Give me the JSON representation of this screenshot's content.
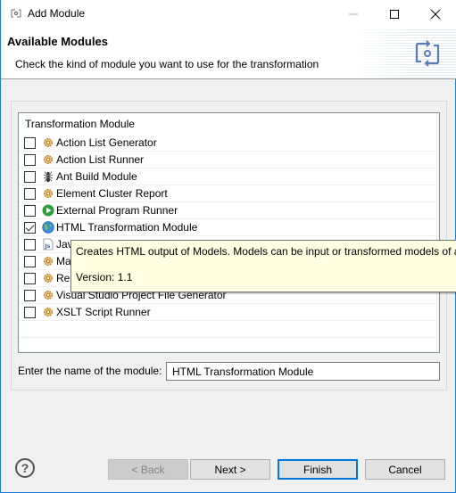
{
  "window": {
    "title": "Add Module",
    "icon": "module-transform-icon",
    "controls": {
      "minimize": "—",
      "maximize": "☐",
      "close": "✕"
    }
  },
  "header": {
    "title": "Available Modules",
    "description": "Check the kind of module you want to use for the transformation",
    "icon": "module-transform-icon"
  },
  "table": {
    "column_header": "Transformation Module",
    "rows": [
      {
        "label": "Action List Generator",
        "icon": "gear-icon",
        "checked": false
      },
      {
        "label": "Action List Runner",
        "icon": "gear-icon",
        "checked": false
      },
      {
        "label": "Ant Build Module",
        "icon": "ant-icon",
        "checked": false
      },
      {
        "label": "Element Cluster Report",
        "icon": "gear-icon",
        "checked": false
      },
      {
        "label": "External Program Runner",
        "icon": "play-icon",
        "checked": false
      },
      {
        "label": "HTML Transformation Module",
        "icon": "globe-icon",
        "checked": true
      },
      {
        "label": "Java",
        "icon": "javascript-file-icon",
        "checked": false
      },
      {
        "label": "Ma",
        "icon": "gear-icon",
        "checked": false
      },
      {
        "label": "Reu",
        "icon": "gear-icon",
        "checked": false
      },
      {
        "label": "Visual Studio Project File Generator",
        "icon": "gear-icon",
        "checked": false
      },
      {
        "label": "XSLT Script Runner",
        "icon": "gear-icon",
        "checked": false
      }
    ]
  },
  "tooltip": {
    "description": "Creates HTML output of Models. Models can be input or transformed models of a",
    "version": "Version: 1.1"
  },
  "name_field": {
    "label": "Enter the name of the module:",
    "value": "HTML Transformation Module"
  },
  "buttons": {
    "help": "?",
    "back": "< Back",
    "next": "Next >",
    "finish": "Finish",
    "cancel": "Cancel"
  }
}
